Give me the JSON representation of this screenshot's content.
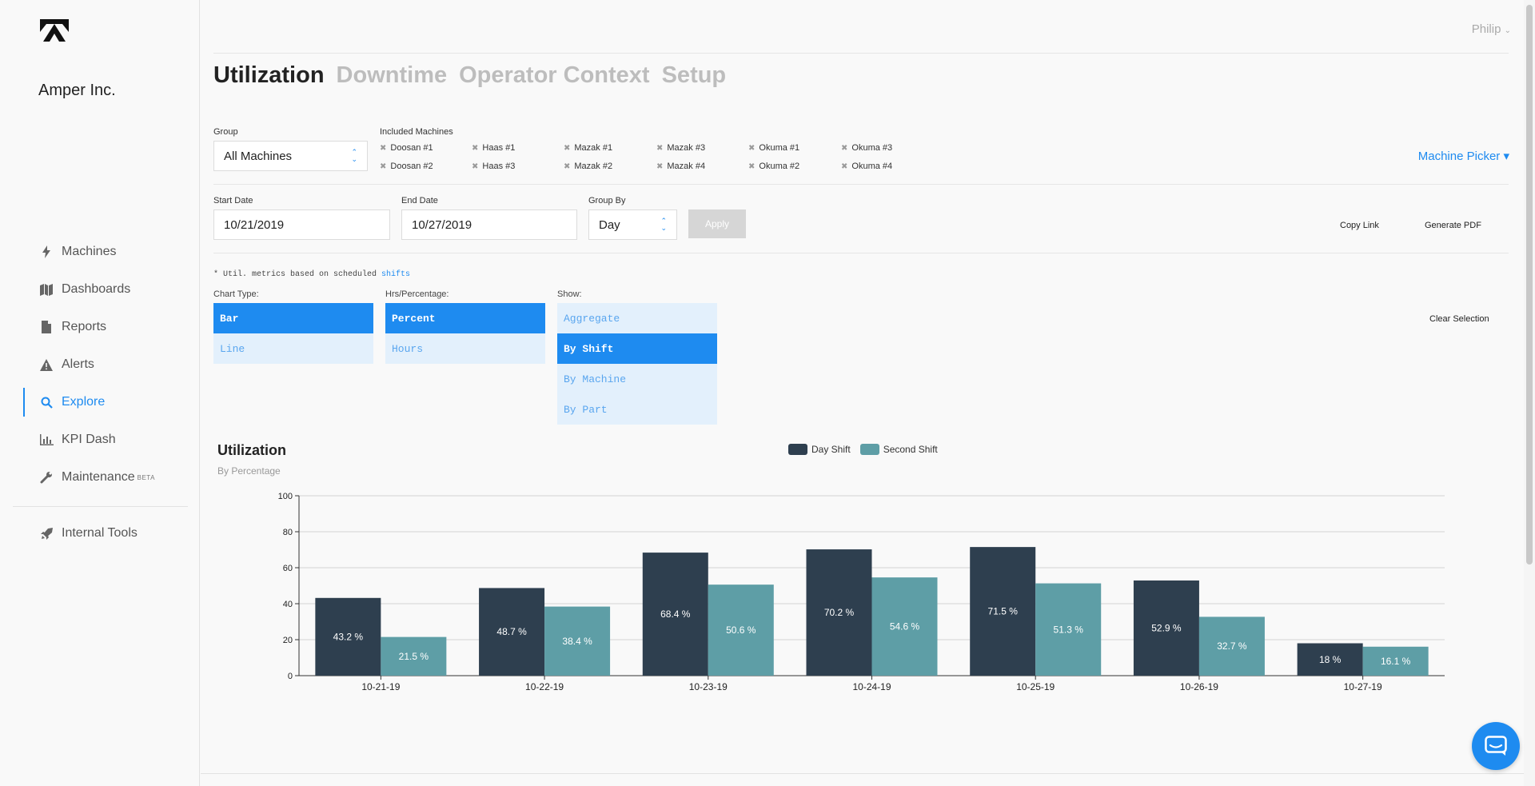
{
  "company": "Amper Inc.",
  "user": "Philip",
  "nav": [
    {
      "label": "Machines",
      "icon": "bolt-icon"
    },
    {
      "label": "Dashboards",
      "icon": "map-icon"
    },
    {
      "label": "Reports",
      "icon": "document-icon"
    },
    {
      "label": "Alerts",
      "icon": "warning-icon"
    },
    {
      "label": "Explore",
      "icon": "search-icon",
      "active": true
    },
    {
      "label": "KPI Dash",
      "icon": "bar-chart-icon"
    },
    {
      "label": "Maintenance",
      "icon": "wrench-icon",
      "badge": "BETA"
    },
    {
      "label": "Internal Tools",
      "icon": "rocket-icon"
    }
  ],
  "tabs": [
    "Utilization",
    "Downtime",
    "Operator Context",
    "Setup"
  ],
  "filters": {
    "group_label": "Group",
    "group_value": "All Machines",
    "machines_label": "Included Machines",
    "machines": [
      "Doosan #1",
      "Doosan #2",
      "Haas #1",
      "Haas #3",
      "Mazak #1",
      "Mazak #2",
      "Mazak #3",
      "Mazak #4",
      "Okuma #1",
      "Okuma #2",
      "Okuma #3",
      "Okuma #4"
    ],
    "machine_picker": "Machine Picker",
    "start_label": "Start Date",
    "start_value": "10/21/2019",
    "end_label": "End Date",
    "end_value": "10/27/2019",
    "groupby_label": "Group By",
    "groupby_value": "Day",
    "apply": "Apply",
    "copy_link": "Copy Link",
    "generate_pdf": "Generate PDF"
  },
  "note": {
    "text": "* Util. metrics based on scheduled ",
    "link": "shifts"
  },
  "options": {
    "chart_type_label": "Chart Type:",
    "chart_type": [
      {
        "label": "Bar",
        "selected": true
      },
      {
        "label": "Line"
      }
    ],
    "hrs_label": "Hrs/Percentage:",
    "hrs": [
      {
        "label": "Percent",
        "selected": true
      },
      {
        "label": "Hours"
      }
    ],
    "show_label": "Show:",
    "show": [
      {
        "label": "Aggregate"
      },
      {
        "label": "By Shift",
        "selected": true
      },
      {
        "label": "By Machine"
      },
      {
        "label": "By Part"
      }
    ],
    "clear": "Clear Selection"
  },
  "chart_data": {
    "type": "bar",
    "title": "Utilization",
    "subtitle": "By Percentage",
    "categories": [
      "10-21-19",
      "10-22-19",
      "10-23-19",
      "10-24-19",
      "10-25-19",
      "10-26-19",
      "10-27-19"
    ],
    "series": [
      {
        "name": "Day Shift",
        "color": "#2e3f4f",
        "values": [
          43.2,
          48.7,
          68.4,
          70.2,
          71.5,
          52.9,
          18
        ],
        "labels": [
          "43.2 %",
          "48.7 %",
          "68.4 %",
          "70.2 %",
          "71.5 %",
          "52.9 %",
          "18 %"
        ]
      },
      {
        "name": "Second Shift",
        "color": "#5e9ea6",
        "values": [
          21.5,
          38.4,
          50.6,
          54.6,
          51.3,
          32.7,
          16.1
        ],
        "labels": [
          "21.5 %",
          "38.4 %",
          "50.6 %",
          "54.6 %",
          "51.3 %",
          "32.7 %",
          "16.1 %"
        ]
      }
    ],
    "ylim": [
      0,
      100
    ],
    "yticks": [
      "0",
      "20",
      "40",
      "60",
      "80",
      "100"
    ],
    "grid": true,
    "legend": "top-center"
  }
}
